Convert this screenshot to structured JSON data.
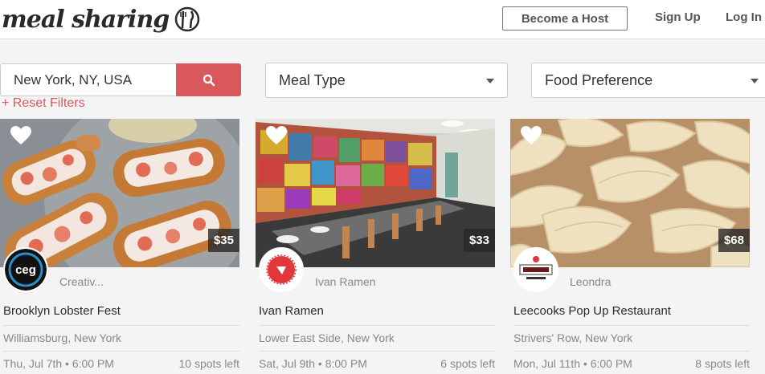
{
  "header": {
    "logo_text": "meal sharing",
    "become_host": "Become a Host",
    "sign_up": "Sign Up",
    "log_in": "Log In"
  },
  "search": {
    "location_value": "New York, NY, USA",
    "meal_type": "Meal Type",
    "food_preference": "Food Preference",
    "reset_filters": "+ Reset Filters"
  },
  "colors": {
    "accent": "#d9585c",
    "text_muted": "#888888"
  },
  "cards": [
    {
      "price": "$35",
      "host": "Creativ...",
      "host_logo_text": "ceg",
      "title": "Brooklyn Lobster Fest",
      "location": "Williamsburg, New York",
      "datetime": "Thu, Jul 7th • 6:00 PM",
      "spots": "10 spots left",
      "image": "lobster-rolls"
    },
    {
      "price": "$33",
      "host": "Ivan Ramen",
      "host_logo_text": "",
      "title": "Ivan Ramen",
      "location": "Lower East Side, New York",
      "datetime": "Sat, Jul 9th • 8:00 PM",
      "spots": "6 spots left",
      "image": "restaurant-interior"
    },
    {
      "price": "$68",
      "host": "Leondra",
      "host_logo_text": "",
      "title": "Leecooks Pop Up Restaurant",
      "location": "Strivers' Row, New York",
      "datetime": "Mon, Jul 11th • 6:00 PM",
      "spots": "8 spots left",
      "image": "dumplings"
    }
  ]
}
